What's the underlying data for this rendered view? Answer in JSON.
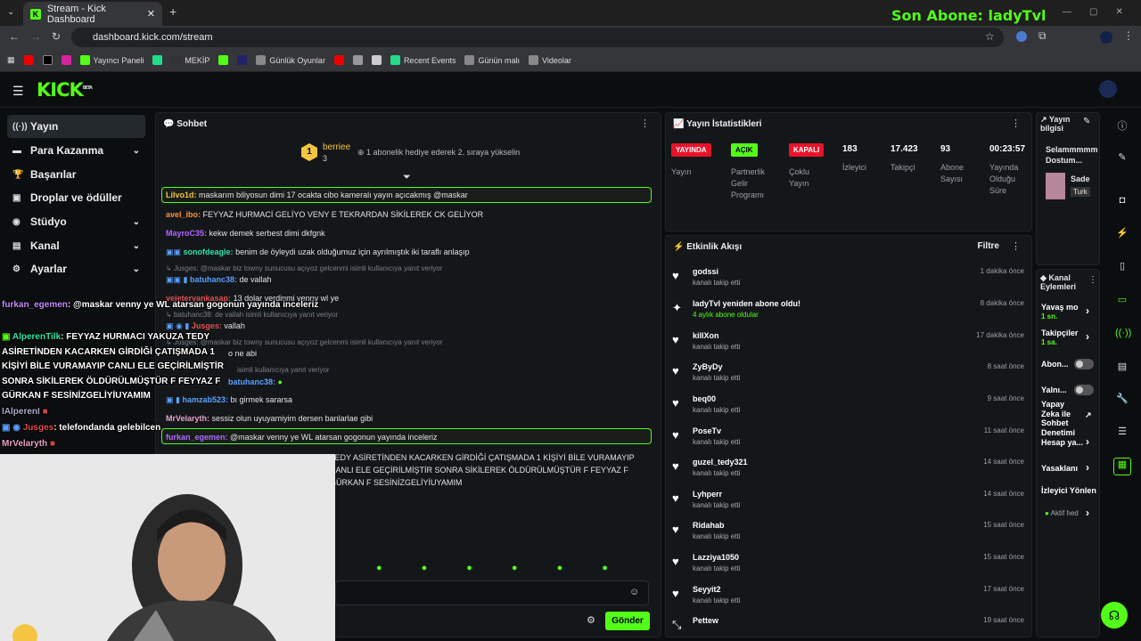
{
  "browser": {
    "tab_title": "Stream - Kick Dashboard",
    "url": "dashboard.kick.com/stream",
    "bookmarks": [
      "Yayıncı Paneli",
      "MEKİP",
      "Günlük Oyunlar",
      "Recent Events",
      "Günün malı",
      "Videolar"
    ]
  },
  "overlay_top": "Son Abone: ladyTvl",
  "logo": "KICK",
  "sidebar": {
    "items": [
      "Yayın",
      "Para Kazanma",
      "Başarılar",
      "Droplar ve ödüller",
      "Stüdyo",
      "Kanal",
      "Ayarlar"
    ]
  },
  "chat": {
    "title": "Sohbet",
    "pinned_user": "berriee",
    "pinned_count": "3",
    "pinned_text": "1 abonelik hediye ederek 2. sıraya yükselin",
    "messages": [
      {
        "user": "Lilvo1d:",
        "text": "maskarım biliyosun dimi 17 ocakta cibo kameralı yayın açıcakmış @maskar",
        "color": "#f5c542"
      },
      {
        "user": "avel_ibo:",
        "text": "FEYYAZ HURMACİ GELİYO VENY E TEKRARDAN SİKİLEREK CK GELİYOR",
        "color": "#f59542"
      },
      {
        "user": "MayroC35:",
        "text": "kekw demek serbest dimi dkfgnk",
        "color": "#b266ff"
      },
      {
        "user": "sonofdeagle:",
        "text": "benim de öyleydi uzak olduğumuz için ayrılmıştık iki taraflı anlaşıp",
        "color": "#2ee6a8"
      },
      {
        "reply": "Jusges: @maskar biz towny sunucusu açıyoz gelcenmi isimli kullanıcıya yanıt veriyor"
      },
      {
        "user": "batuhanc38:",
        "text": "de vallah",
        "color": "#5aa0ff"
      },
      {
        "user": "vejeteryankasap:",
        "text": "13 dolar verdinmi venny wl ye",
        "color": "#e24d4d"
      },
      {
        "reply": "batuhanc38: de vallah isimli kullanıcıya yanıt veriyor"
      },
      {
        "user": "Jusges:",
        "text": "vallah",
        "color": "#e24d4d"
      },
      {
        "reply": "Jusges: @maskar biz towny sunucusu açıyoz gelcenmi isimli kullanıcıya yanıt veriyor"
      },
      {
        "user": "",
        "text": "o ne abi",
        "color": "#ffffff"
      },
      {
        "reply": "isimli kullanıcıya yanıt veriyor"
      },
      {
        "user": "batuhanc38:",
        "text": "",
        "color": "#5aa0ff"
      },
      {
        "user": "hamzab523:",
        "text": "bı girmek sararsa",
        "color": "#5aa0ff"
      },
      {
        "user": "MrVelaryth:",
        "text": "sessiz olun uyuyamiyim dersen banlarlae gibi",
        "color": "#e8a0c8"
      },
      {
        "user": "furkan_egemen:",
        "text": "@maskar venny ye WL atarsan gogonun yayında inceleriz",
        "color": "#b266ff"
      },
      {
        "user": "",
        "text": "TEDY ASİRETİNDEN KACARKEN GİRDİĞİ ÇATIŞMADA 1 KİŞİYİ BİLE VURAMAYIP CANLI ELE GEÇİRİLMİŞTİR SONRA SİKİLEREK ÖLDÜRÜLMÜŞTÜR F FEYYAZ F GÜRKAN F SESİNİZGELİYİUYAMIM",
        "color": "#ffffff"
      }
    ],
    "send_label": "Gönder"
  },
  "overlay_chat": [
    {
      "user": "furkan_egemen",
      "text": ": @maskar venny ye WL atarsan gogonun yayında inceleriz"
    },
    {
      "user": "AlperenTilk",
      "text": ": FEYYAZ HURMACI YAKUZA TEDY ASİRETİNDEN KACARKEN GİRDİĞİ ÇATIŞMADA 1 KİŞİYİ BİLE VURAMAYIP CANLI ELE GEÇİRİLMİŞTİR SONRA SİKİLEREK ÖLDÜRÜLMÜŞTÜR F FEYYAZ F GÜRKAN F SESİNİZGELİYİUYAMIM"
    },
    {
      "user": "IAlperenI",
      "text": ""
    },
    {
      "user": "Jusges",
      "text": ": telefondanda gelebilcen"
    },
    {
      "user": "MrVelaryth",
      "text": ""
    }
  ],
  "stats": {
    "title": "Yayın İstatistikleri",
    "items": [
      {
        "badge": "YAYINDA",
        "label": "Yayın",
        "badge_color": "#e8132a"
      },
      {
        "badge": "AÇIK",
        "label": "Partnerlik Gelir Programı",
        "badge_color": "#53fc18"
      },
      {
        "badge": "KAPALI",
        "label": "Çoklu Yayın",
        "badge_color": "#e8132a"
      },
      {
        "value": "183",
        "label": "İzleyici"
      },
      {
        "value": "17.423",
        "label": "Takipçi"
      },
      {
        "value": "93",
        "label": "Abone Sayısı"
      },
      {
        "value": "00:23:57",
        "label": "Yayında Olduğu Süre"
      }
    ]
  },
  "activity": {
    "title": "Etkinlik Akışı",
    "filter": "Filtre",
    "items": [
      {
        "name": "godssi",
        "sub": "kanalı takip etti",
        "time": "1 dakika önce"
      },
      {
        "name": "ladyTvl yeniden abone oldu!",
        "sub": "4 aylık abone oldular",
        "time": "8 dakika önce"
      },
      {
        "name": "killXon",
        "sub": "kanalı takip etti",
        "time": "17 dakika önce"
      },
      {
        "name": "ZyByDy",
        "sub": "kanalı takip etti",
        "time": "8 saat önce"
      },
      {
        "name": "beq00",
        "sub": "kanalı takip etti",
        "time": "9 saat önce"
      },
      {
        "name": "PoseTv",
        "sub": "kanalı takip etti",
        "time": "11 saat önce"
      },
      {
        "name": "guzel_tedy321",
        "sub": "kanalı takip etti",
        "time": "14 saat önce"
      },
      {
        "name": "Lyhperr",
        "sub": "kanalı takip etti",
        "time": "14 saat önce"
      },
      {
        "name": "Ridahab",
        "sub": "kanalı takip etti",
        "time": "15 saat önce"
      },
      {
        "name": "Lazziya1050",
        "sub": "kanalı takip etti",
        "time": "15 saat önce"
      },
      {
        "name": "Seyyit2",
        "sub": "kanalı takip etti",
        "time": "17 saat önce"
      },
      {
        "name": "Pettew",
        "sub": "",
        "time": "19 saat önce"
      }
    ]
  },
  "stream_info": {
    "title": "Yayın bilgisi",
    "text": "Selammmmm Dostum...",
    "category": "Sade",
    "lang": "Turk"
  },
  "channel_actions": {
    "title": "Kanal Eylemleri",
    "items": [
      {
        "label": "Yavaş mo",
        "sub": "1 sn."
      },
      {
        "label": "Takipçiler",
        "sub": "1 sa."
      },
      {
        "label": "Abon..."
      },
      {
        "label": "Yalnı..."
      },
      {
        "label": "Yapay Zeka ile Sohbet Denetimi"
      },
      {
        "label": "Hesap ya..."
      },
      {
        "label": "Yasaklanı"
      },
      {
        "label": "İzleyici Yönlen"
      },
      {
        "label": "Aktif hed"
      }
    ]
  },
  "colors": {
    "accent": "#53fc18",
    "live": "#e8132a"
  }
}
